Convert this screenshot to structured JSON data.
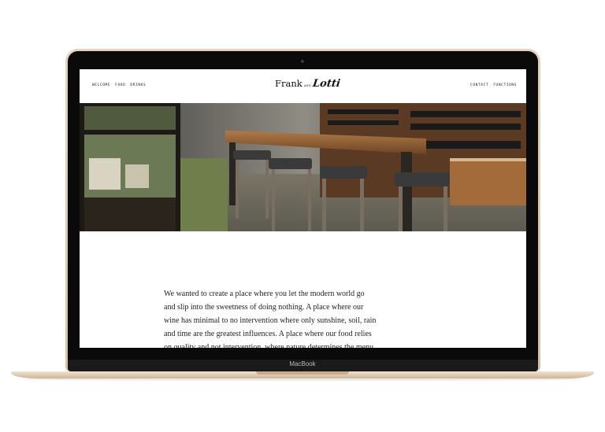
{
  "device": {
    "brand_label": "MacBook"
  },
  "site": {
    "nav_left": [
      "WELCOME",
      "FOOD",
      "DRINKS"
    ],
    "nav_right": [
      "CONTACT",
      "FUNCTIONS"
    ],
    "logo": {
      "part1": "Frank",
      "part2": "AND",
      "part3": "Lotti"
    }
  },
  "intro": {
    "text": "We wanted to create a place where you let the modern world go and slip into the sweetness of doing nothing. A place where our wine has minimal to no intervention where only sunshine, soil, rain and time are the greatest influences. A place where our food relies on quality and not intervention, where nature determines the menu."
  },
  "colors": {
    "lid": "#e6d3bd",
    "wood": "#8a5a32",
    "text": "#1f1f1f"
  }
}
